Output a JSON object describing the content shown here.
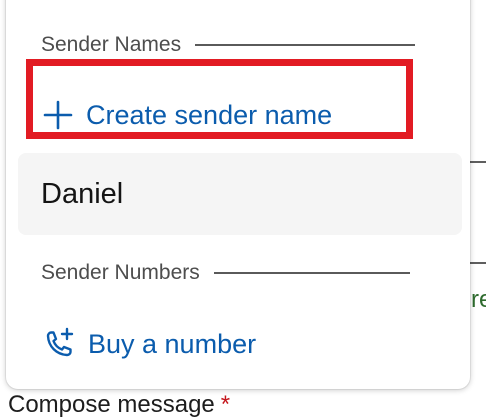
{
  "dropdown": {
    "sender_names_header": "Sender Names",
    "create_sender_name_label": "Create sender name",
    "sender_names": [
      "Daniel"
    ],
    "sender_numbers_header": "Sender Numbers",
    "buy_number_label": "Buy a number"
  },
  "background": {
    "peek_text": "re",
    "compose_label": "Compose message",
    "required_marker": "*"
  },
  "colors": {
    "accent": "#0b5cad",
    "highlight": "#e21b23",
    "required": "#c4161c",
    "option_bg": "#f5f5f5"
  },
  "icons": {
    "create": "plus-icon",
    "buy": "phone-plus-icon"
  }
}
